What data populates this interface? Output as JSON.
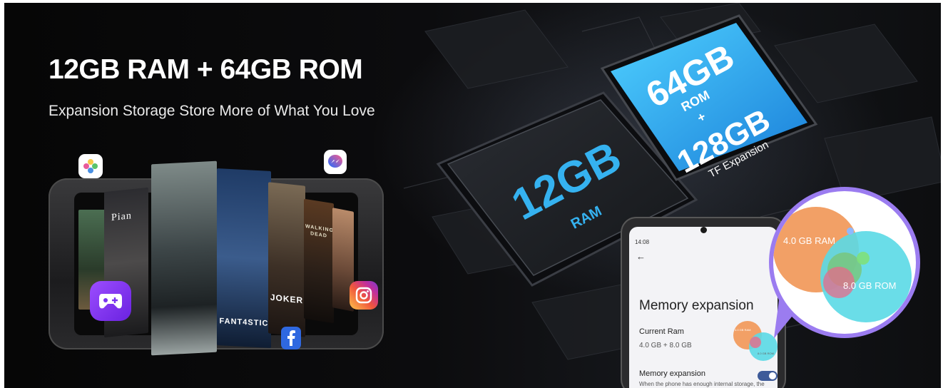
{
  "header": {
    "headline": "12GB RAM + 64GB ROM",
    "subline": "Expansion Storage Store More of What You Love"
  },
  "chips": {
    "ram_capacity": "12GB",
    "ram_label": "RAM",
    "rom_capacity": "64GB",
    "rom_label": "ROM",
    "plus": "+",
    "expansion_capacity": "128GB",
    "expansion_label": "TF Expansion"
  },
  "posters": {
    "piano": "Pian",
    "fantastic": "FANT4STIC",
    "joker": "JOKER",
    "dead": "WALKING DEAD"
  },
  "phone_screen": {
    "status_time": "14:08",
    "title": "Memory expansion",
    "current_ram_label": "Current Ram",
    "current_ram_value": "4.0 GB + 8.0 GB",
    "expansion_label": "Memory expansion",
    "expansion_desc": "When the phone has enough internal storage, the storage space can be expanded",
    "mini_ram": "4.0 GB RAM",
    "mini_rom": "8.0 GB ROM"
  },
  "bubble": {
    "ram_label": "4.0 GB RAM",
    "rom_label": "8.0 GB ROM"
  },
  "colors": {
    "chip_cyan": "#2fb8ee",
    "chip_blue": "#1f7fd8",
    "bubble_border": "#9b7cf0",
    "ram_circle": "#f2a066",
    "rom_circle": "#5ad9e6",
    "toggle": "#3d5a99"
  },
  "icons": {
    "photos": "photos-app-icon",
    "messenger": "messenger-app-icon",
    "game": "game-controller-app-icon",
    "instagram": "instagram-app-icon",
    "facebook": "facebook-app-icon"
  }
}
